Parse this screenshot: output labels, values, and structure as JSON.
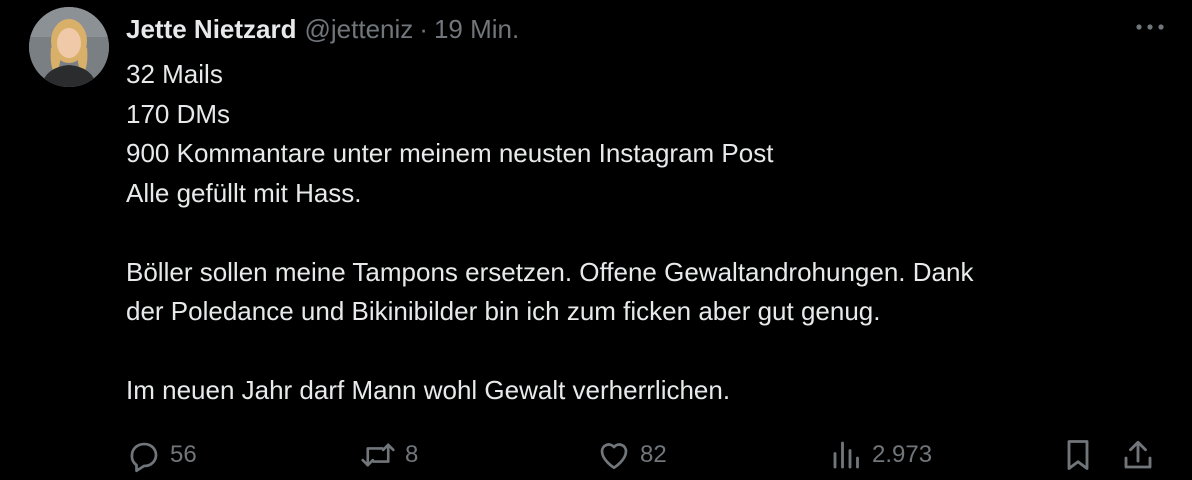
{
  "tweet": {
    "author": {
      "display_name": "Jette Nietzard",
      "handle": "@jetteniz",
      "separator": "·",
      "time": "19 Min."
    },
    "body_lines": [
      "32 Mails",
      "170 DMs",
      "900 Kommantare unter meinem neusten Instagram Post",
      "Alle gefüllt mit Hass.",
      "",
      "Böller sollen meine Tampons ersetzen. Offene Gewaltandrohungen. Dank",
      "der Poledance und Bikinibilder bin ich zum ficken aber gut genug.",
      "",
      "Im neuen Jahr darf Mann wohl Gewalt verherrlichen."
    ],
    "metrics": {
      "replies": "56",
      "reposts": "8",
      "likes": "82",
      "views": "2.973"
    },
    "icons": {
      "more": "more-dots-icon",
      "reply": "reply-icon",
      "repost": "repost-icon",
      "like": "heart-icon",
      "views": "views-icon",
      "bookmark": "bookmark-icon",
      "share": "share-icon"
    },
    "colors": {
      "background": "#000000",
      "text": "#e7e9ea",
      "secondary": "#71767b"
    }
  }
}
